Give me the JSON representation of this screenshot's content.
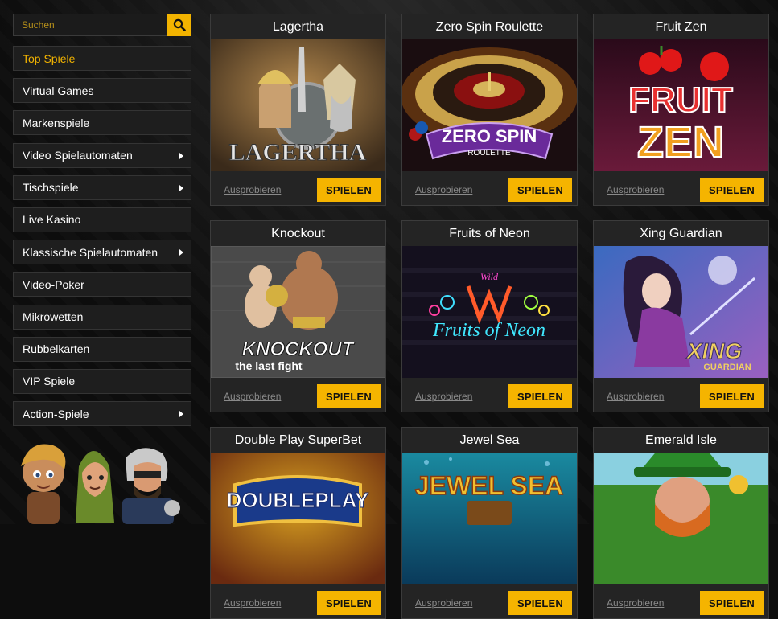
{
  "search": {
    "placeholder": "Suchen",
    "icon": "search-icon"
  },
  "menu": {
    "items": [
      {
        "label": "Top Spiele",
        "active": true,
        "has_arrow": false
      },
      {
        "label": "Virtual Games",
        "active": false,
        "has_arrow": false
      },
      {
        "label": "Markenspiele",
        "active": false,
        "has_arrow": false
      },
      {
        "label": "Video Spielautomaten",
        "active": false,
        "has_arrow": true
      },
      {
        "label": "Tischspiele",
        "active": false,
        "has_arrow": true
      },
      {
        "label": "Live Kasino",
        "active": false,
        "has_arrow": false
      },
      {
        "label": "Klassische Spielautomaten",
        "active": false,
        "has_arrow": true
      },
      {
        "label": "Video-Poker",
        "active": false,
        "has_arrow": false
      },
      {
        "label": "Mikrowetten",
        "active": false,
        "has_arrow": false
      },
      {
        "label": "Rubbelkarten",
        "active": false,
        "has_arrow": false
      },
      {
        "label": "VIP Spiele",
        "active": false,
        "has_arrow": false
      },
      {
        "label": "Action-Spiele",
        "active": false,
        "has_arrow": true
      }
    ]
  },
  "games": [
    {
      "title": "Lagertha",
      "art_text": "LAGERTHA",
      "try_label": "Ausprobieren",
      "play_label": "SPIELEN"
    },
    {
      "title": "Zero Spin Roulette",
      "art_text": "ZERO SPIN",
      "art_sub": "ROULETTE",
      "try_label": "Ausprobieren",
      "play_label": "SPIELEN"
    },
    {
      "title": "Fruit Zen",
      "art_text": "FRUIT",
      "art_sub": "ZEN",
      "try_label": "Ausprobieren",
      "play_label": "SPIELEN"
    },
    {
      "title": "Knockout",
      "art_text": "KNOCKOUT",
      "art_sub": "the last fight",
      "try_label": "Ausprobieren",
      "play_label": "SPIELEN"
    },
    {
      "title": "Fruits of Neon",
      "art_text": "Fruits of Neon",
      "art_sub": "Wild",
      "try_label": "Ausprobieren",
      "play_label": "SPIELEN"
    },
    {
      "title": "Xing Guardian",
      "art_text": "XING",
      "art_sub": "GUARDIAN",
      "try_label": "Ausprobieren",
      "play_label": "SPIELEN"
    },
    {
      "title": "Double Play SuperBet",
      "art_text": "DOUBLEPLAY",
      "try_label": "Ausprobieren",
      "play_label": "SPIELEN"
    },
    {
      "title": "Jewel Sea",
      "art_text": "JEWEL SEA",
      "try_label": "Ausprobieren",
      "play_label": "SPIELEN"
    },
    {
      "title": "Emerald Isle",
      "art_text": "",
      "try_label": "Ausprobieren",
      "play_label": "SPIELEN"
    }
  ],
  "colors": {
    "accent": "#f5b400",
    "card_bg": "#242424",
    "page_bg": "#0d0d0d"
  }
}
